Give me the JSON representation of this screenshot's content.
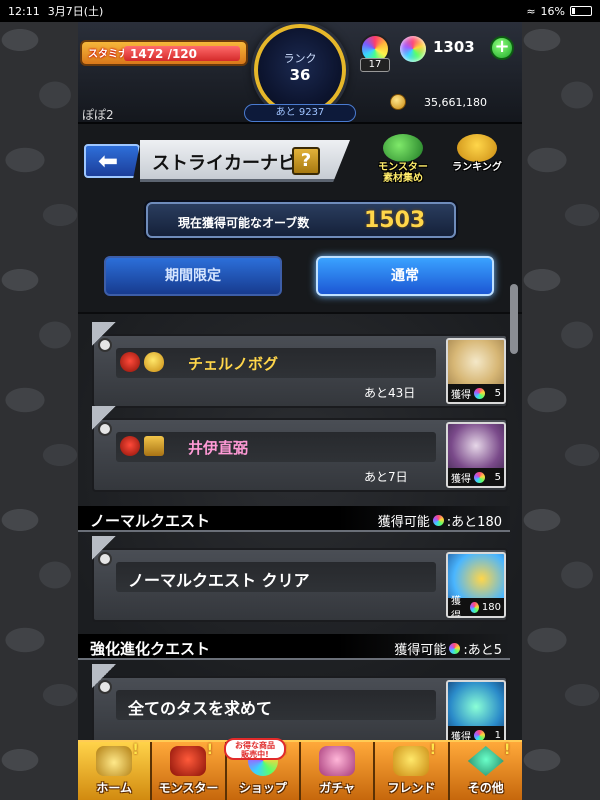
{
  "status_bar": {
    "time": "12:11",
    "date": "3月7日(土)",
    "battery": "16%"
  },
  "header": {
    "stamina_label": "スタミナ",
    "stamina_value": "1472 /120",
    "rank_label": "ランク",
    "rank_value": "36",
    "exp_remaining": "あと 9237",
    "crystal_count": "17",
    "orb_count": "1303",
    "player_name": "ぽぽ2",
    "gold": "35,661,180"
  },
  "title_row": {
    "title": "ストライカーナビ",
    "help_label": "?",
    "collect_label": "モンスター\n素材集め",
    "ranking_label": "ランキング"
  },
  "orb_banner": {
    "label": "現在獲得可能なオーブ数",
    "value": "1503"
  },
  "tabs": {
    "limited": "期間限定",
    "normal": "通常"
  },
  "events": [
    {
      "title": "チェルノボグ",
      "remaining": "あと43日",
      "reward_label": "獲得",
      "reward_count": "5"
    },
    {
      "title": "井伊直弼",
      "remaining": "あと7日",
      "reward_label": "獲得",
      "reward_count": "5"
    }
  ],
  "normal_section": {
    "name": "ノーマルクエスト",
    "avail_label": "獲得可能",
    "avail_value": ":あと180"
  },
  "normal_quest": {
    "title": "ノーマルクエスト クリア",
    "reward_label": "獲得",
    "reward_count": "180"
  },
  "evolve_section": {
    "name": "強化進化クエスト",
    "avail_label": "獲得可能",
    "avail_value": ":あと5"
  },
  "evolve_quest": {
    "title": "全てのタスを求めて",
    "reward_label": "獲得",
    "reward_count": "1"
  },
  "sale_badge": "お得な商品\n販売中!",
  "nav": {
    "home": "ホーム",
    "monster": "モンスター",
    "shop": "ショップ",
    "gacha": "ガチャ",
    "friend": "フレンド",
    "other": "その他"
  },
  "colors": {
    "accent_gold": "#ffd64a",
    "tab_active": "#3aa2ff",
    "nav_orange": "#ffa93a"
  }
}
